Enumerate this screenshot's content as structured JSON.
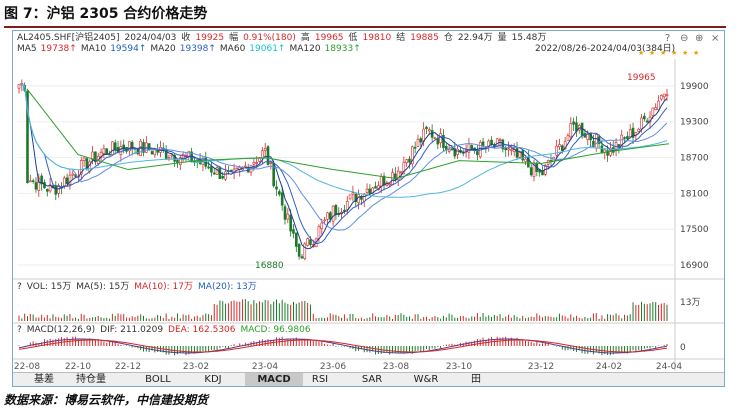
{
  "figure": {
    "title": "图 7：沪铝 2305 合约价格走势",
    "source": "数据来源：博易云软件，中信建投期货"
  },
  "header": {
    "row1": [
      {
        "text": "AL2405.SHF[沪铝2405]",
        "color": "#333333"
      },
      {
        "text": "2024/04/03",
        "color": "#333333"
      },
      {
        "text": "收",
        "color": "#333333"
      },
      {
        "text": "19925",
        "color": "#d62728"
      },
      {
        "text": "幅",
        "color": "#333333"
      },
      {
        "text": "0.91%(180)",
        "color": "#d62728"
      },
      {
        "text": "高",
        "color": "#333333"
      },
      {
        "text": "19965",
        "color": "#d62728"
      },
      {
        "text": "低",
        "color": "#333333"
      },
      {
        "text": "19810",
        "color": "#d62728"
      },
      {
        "text": "结",
        "color": "#333333"
      },
      {
        "text": "19885",
        "color": "#d62728"
      },
      {
        "text": "仓",
        "color": "#333333"
      },
      {
        "text": "22.94万",
        "color": "#333333"
      },
      {
        "text": "量",
        "color": "#333333"
      },
      {
        "text": "15.48万",
        "color": "#333333"
      }
    ],
    "row2": [
      {
        "text": "MA5",
        "color": "#333333"
      },
      {
        "text": "19738↑",
        "color": "#d62728"
      },
      {
        "text": "MA10",
        "color": "#333333"
      },
      {
        "text": "19594↑",
        "color": "#1f5fbf"
      },
      {
        "text": "MA20",
        "color": "#333333"
      },
      {
        "text": "19398↑",
        "color": "#2f5fc8"
      },
      {
        "text": "MA60",
        "color": "#333333"
      },
      {
        "text": "19061↑",
        "color": "#17becf"
      },
      {
        "text": "MA120",
        "color": "#333333"
      },
      {
        "text": "18933↑",
        "color": "#2ca02c"
      }
    ],
    "range": "2022/08/26-2024/04/03(384日)",
    "controls": [
      "?",
      "⊖",
      "⊕",
      "×"
    ]
  },
  "colors": {
    "up": "#d62728",
    "down": "#1a7a2a",
    "ma5": "#1a3f8f",
    "ma10": "#2f5fc8",
    "ma20": "#5f8ee0",
    "ma60": "#4fb8dc",
    "ma120": "#2ca02c",
    "macd_dif": "#5a3a8a",
    "macd_dea": "#d62728"
  },
  "volume_header": [
    {
      "text": "?",
      "color": "#333333"
    },
    {
      "text": "VOL: 15万",
      "color": "#333333"
    },
    {
      "text": "MA(5): 15万",
      "color": "#333333"
    },
    {
      "text": "MA(10): 17万",
      "color": "#d62728"
    },
    {
      "text": "MA(20): 13万",
      "color": "#1f5fbf"
    }
  ],
  "macd_header": [
    {
      "text": "?",
      "color": "#333333"
    },
    {
      "text": "MACD(12,26,9)",
      "color": "#333333"
    },
    {
      "text": "DIF: 211.0209",
      "color": "#333333"
    },
    {
      "text": "DEA: 162.5306",
      "color": "#d62728"
    },
    {
      "text": "MACD: 96.9806",
      "color": "#2ca02c"
    }
  ],
  "tabs": [
    "基差",
    "持仓量",
    "BOLL",
    "KDJ",
    "MACD",
    "RSI",
    "SAR",
    "W&R",
    "田"
  ],
  "active_tab": "MACD",
  "chart_data": {
    "type": "line",
    "description_series": "candlestick daily price with moving averages, volume and MACD subplots",
    "x_ticks": [
      "22-08",
      "22-10",
      "22-12",
      "23-02",
      "23-04",
      "23-06",
      "23-08",
      "23-10",
      "23-12",
      "24-02",
      "24-04"
    ],
    "price_ticks": [
      19900,
      19300,
      18700,
      18100,
      17500,
      16900
    ],
    "ylim": [
      16800,
      20150
    ],
    "annotations": [
      {
        "text": "19965",
        "x": "24-04",
        "y": 19965
      },
      {
        "text": "16880",
        "x": "23-05",
        "y": 16880
      }
    ],
    "volume_ticks": [
      "13万"
    ],
    "macd_ticks": [
      "0"
    ],
    "close": [
      {
        "x": "22-08",
        "y": 18350
      },
      {
        "x": "22-09",
        "y": 18150
      },
      {
        "x": "22-10",
        "y": 18500
      },
      {
        "x": "22-11",
        "y": 18800
      },
      {
        "x": "22-12",
        "y": 18900
      },
      {
        "x": "23-01",
        "y": 18800
      },
      {
        "x": "23-02",
        "y": 18650
      },
      {
        "x": "23-03",
        "y": 18350
      },
      {
        "x": "23-04",
        "y": 18800
      },
      {
        "x": "23-05",
        "y": 17050
      },
      {
        "x": "23-06",
        "y": 17800
      },
      {
        "x": "23-07",
        "y": 18150
      },
      {
        "x": "23-08",
        "y": 18450
      },
      {
        "x": "23-09",
        "y": 19150
      },
      {
        "x": "23-10",
        "y": 18800
      },
      {
        "x": "23-11",
        "y": 18900
      },
      {
        "x": "23-12",
        "y": 18400
      },
      {
        "x": "24-01",
        "y": 19250
      },
      {
        "x": "24-02",
        "y": 18800
      },
      {
        "x": "24-03",
        "y": 19200
      },
      {
        "x": "24-04",
        "y": 19925
      }
    ],
    "ma120": [
      {
        "x": "22-08",
        "y": 19850
      },
      {
        "x": "22-10",
        "y": 18750
      },
      {
        "x": "22-12",
        "y": 18500
      },
      {
        "x": "23-02",
        "y": 18650
      },
      {
        "x": "23-04",
        "y": 18700
      },
      {
        "x": "23-06",
        "y": 18500
      },
      {
        "x": "23-08",
        "y": 18350
      },
      {
        "x": "23-10",
        "y": 18650
      },
      {
        "x": "23-12",
        "y": 18600
      },
      {
        "x": "24-02",
        "y": 18800
      },
      {
        "x": "24-04",
        "y": 18933
      }
    ]
  }
}
